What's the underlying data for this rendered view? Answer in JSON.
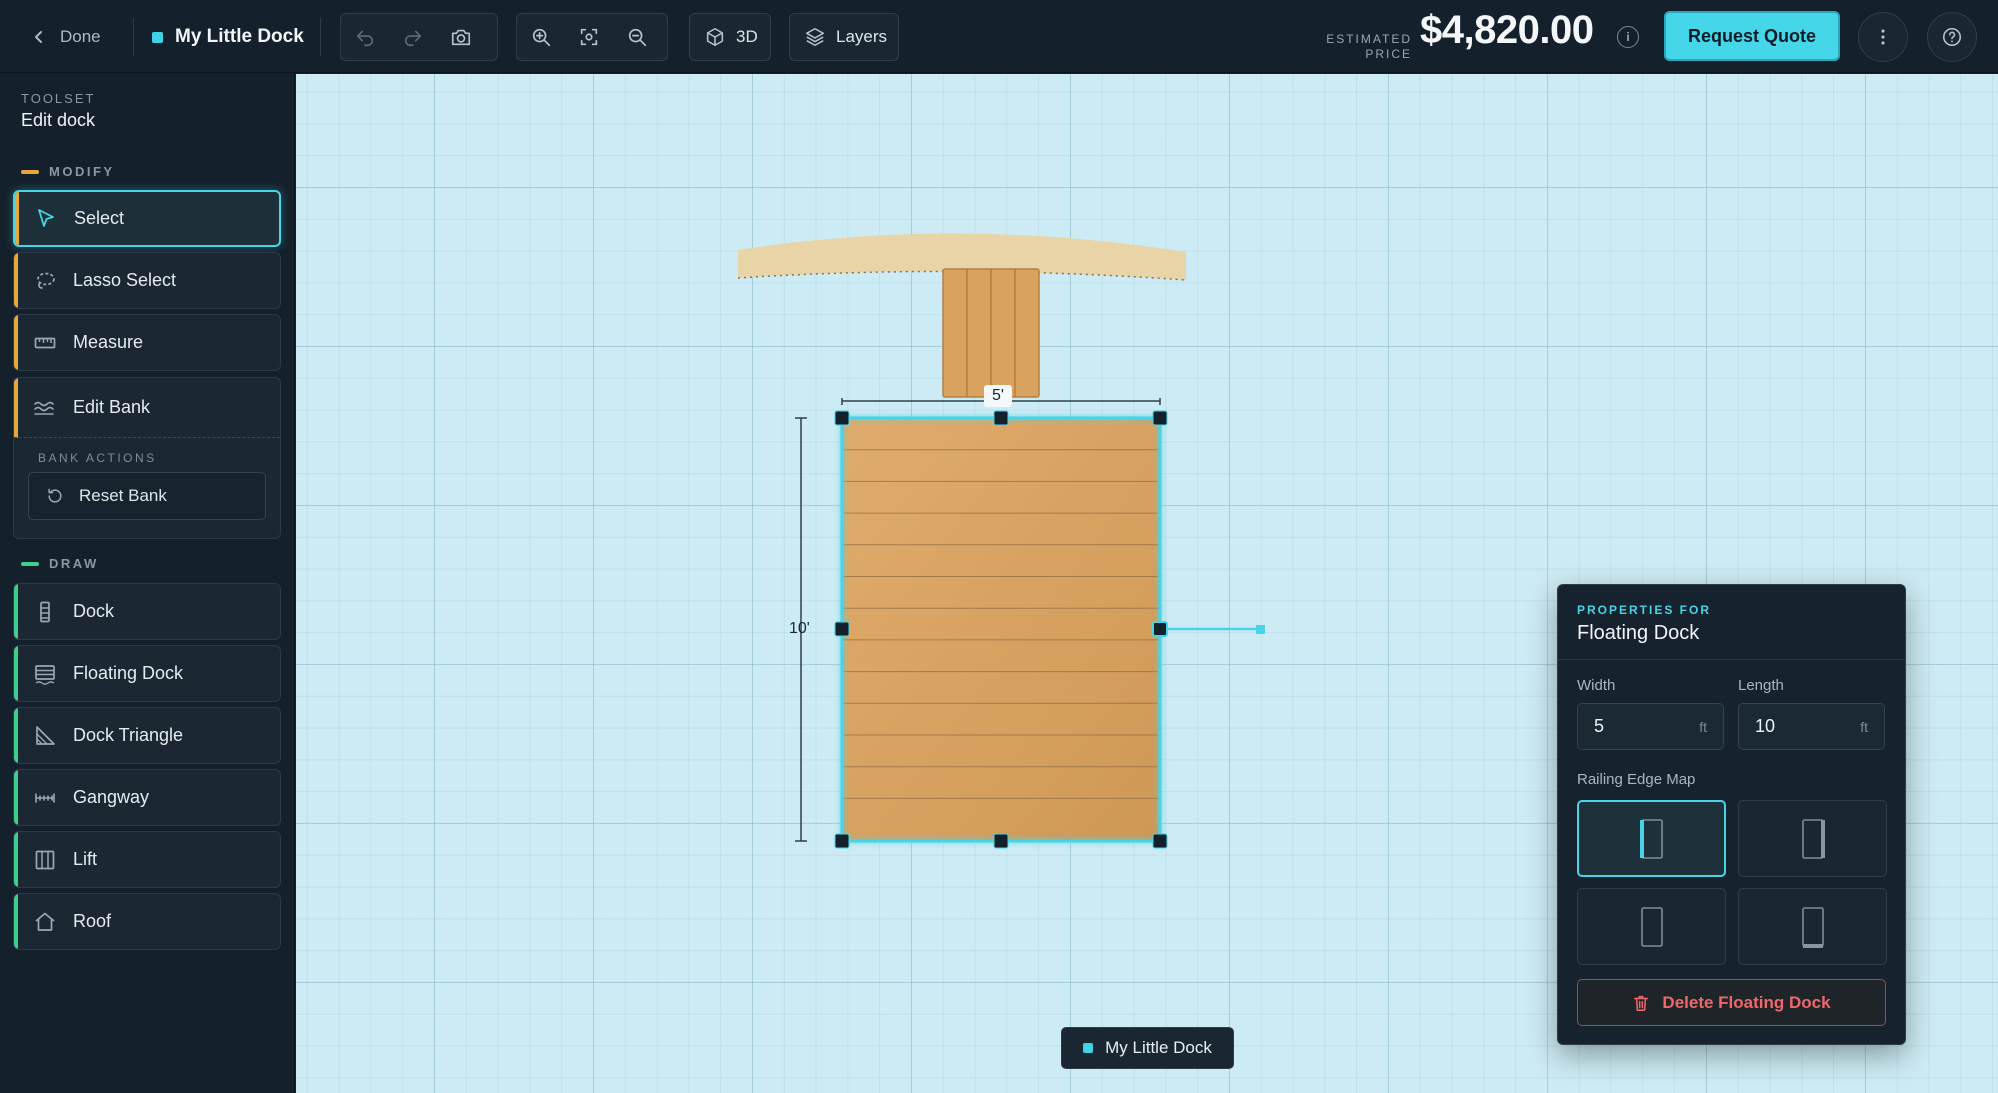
{
  "topbar": {
    "done_label": "Done",
    "project_name": "My Little Dock",
    "view_3d_label": "3D",
    "layers_label": "Layers",
    "estimated_label_line1": "ESTIMATED",
    "estimated_label_line2": "PRICE",
    "price": "$4,820.00",
    "info_glyph": "i",
    "request_quote_label": "Request Quote"
  },
  "sidebar": {
    "toolset_label": "TOOLSET",
    "toolset_title": "Edit dock",
    "modify_label": "MODIFY",
    "modify_items": [
      {
        "label": "Select",
        "icon": "cursor-icon",
        "active": true
      },
      {
        "label": "Lasso Select",
        "icon": "lasso-icon"
      },
      {
        "label": "Measure",
        "icon": "ruler-icon"
      },
      {
        "label": "Edit Bank",
        "icon": "waves-icon"
      }
    ],
    "bank_actions_label": "BANK ACTIONS",
    "reset_bank_label": "Reset Bank",
    "draw_label": "DRAW",
    "draw_items": [
      {
        "label": "Dock",
        "icon": "dock-icon"
      },
      {
        "label": "Floating Dock",
        "icon": "floating-dock-icon"
      },
      {
        "label": "Dock Triangle",
        "icon": "triangle-icon"
      },
      {
        "label": "Gangway",
        "icon": "gangway-icon"
      },
      {
        "label": "Lift",
        "icon": "lift-icon"
      },
      {
        "label": "Roof",
        "icon": "roof-icon"
      }
    ],
    "colors": {
      "modify_accent": "#e4a93a",
      "draw_accent": "#3ecf8e",
      "active": "#48d3e6"
    }
  },
  "canvas": {
    "width_label": "5'",
    "length_label": "10'"
  },
  "properties": {
    "for_label": "PROPERTIES FOR",
    "title": "Floating Dock",
    "width_label": "Width",
    "width_value": "5",
    "width_unit": "ft",
    "length_label": "Length",
    "length_value": "10",
    "length_unit": "ft",
    "railing_label": "Railing Edge Map",
    "railing_selected_index": 0,
    "delete_label": "Delete Floating Dock"
  },
  "bottom_tag": {
    "label": "My Little Dock"
  }
}
